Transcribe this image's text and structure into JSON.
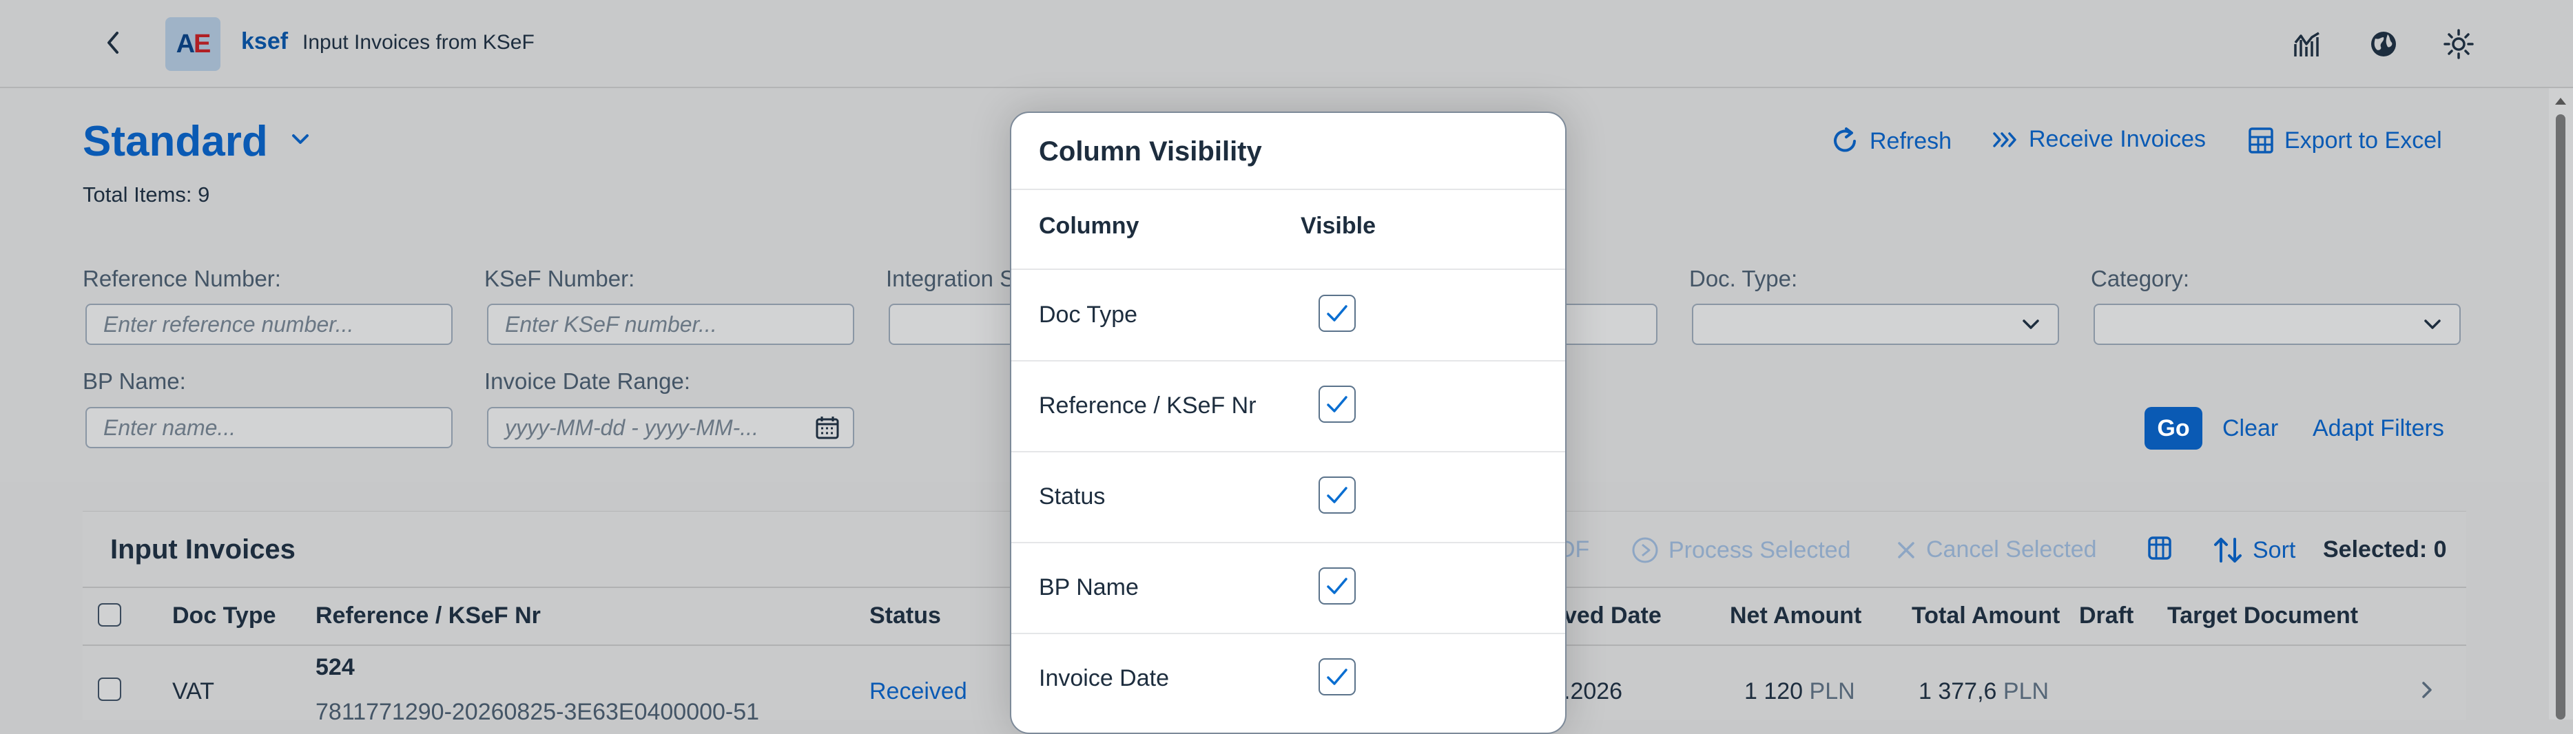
{
  "shell": {
    "logo_text_a": "A",
    "logo_text_e": "E",
    "app_name": "ksef",
    "app_subtitle": "Input Invoices from KSeF",
    "icons": [
      "back-icon",
      "analytics-icon",
      "globe-icon",
      "theme-icon"
    ]
  },
  "header": {
    "variant": "Standard",
    "total_items": "Total Items: 9",
    "actions": {
      "refresh": "Refresh",
      "receive": "Receive Invoices",
      "export": "Export to Excel"
    }
  },
  "filters": {
    "reference_label": "Reference Number:",
    "reference_placeholder": "Enter reference number...",
    "ksef_label": "KSeF Number:",
    "ksef_placeholder": "Enter KSeF number...",
    "integration_label": "Integration S",
    "doc_type_label": "Doc. Type:",
    "category_label": "Category:",
    "bp_label": "BP Name:",
    "bp_placeholder": "Enter name...",
    "date_label": "Invoice Date Range:",
    "date_placeholder": "yyyy-MM-dd - yyyy-MM-...",
    "go": "Go",
    "clear": "Clear",
    "adapt": "Adapt Filters"
  },
  "table": {
    "title": "Input Invoices",
    "toolbar": {
      "partial_pdf": "DF",
      "process": "Process Selected",
      "cancel": "Cancel Selected",
      "sort": "Sort",
      "selected": "Selected: 0"
    },
    "columns": {
      "doc_type": "Doc Type",
      "reference": "Reference / KSeF Nr",
      "status": "Status",
      "received_partial": "ved Date",
      "net": "Net Amount",
      "total": "Total Amount",
      "draft": "Draft",
      "target": "Target Document"
    },
    "rows": [
      {
        "doc_type": "VAT",
        "reference": "524",
        "ksef_nr": "7811771290-20260825-3E63E0400000-51",
        "status": "Received",
        "received_partial": ".2026",
        "net_value": "1 120",
        "net_currency": "PLN",
        "total_value": "1 377,6",
        "total_currency": "PLN"
      }
    ]
  },
  "dialog": {
    "title": "Column Visibility",
    "col_header": "Columny",
    "vis_header": "Visible",
    "rows": [
      {
        "label": "Doc Type",
        "checked": true
      },
      {
        "label": "Reference / KSeF Nr",
        "checked": true
      },
      {
        "label": "Status",
        "checked": true
      },
      {
        "label": "BP Name",
        "checked": true
      },
      {
        "label": "Invoice Date",
        "checked": true
      }
    ]
  },
  "colors": {
    "accent": "#0a5ab4",
    "status_link": "#0a5ab4",
    "dim_bg": "#c8c9ca"
  }
}
